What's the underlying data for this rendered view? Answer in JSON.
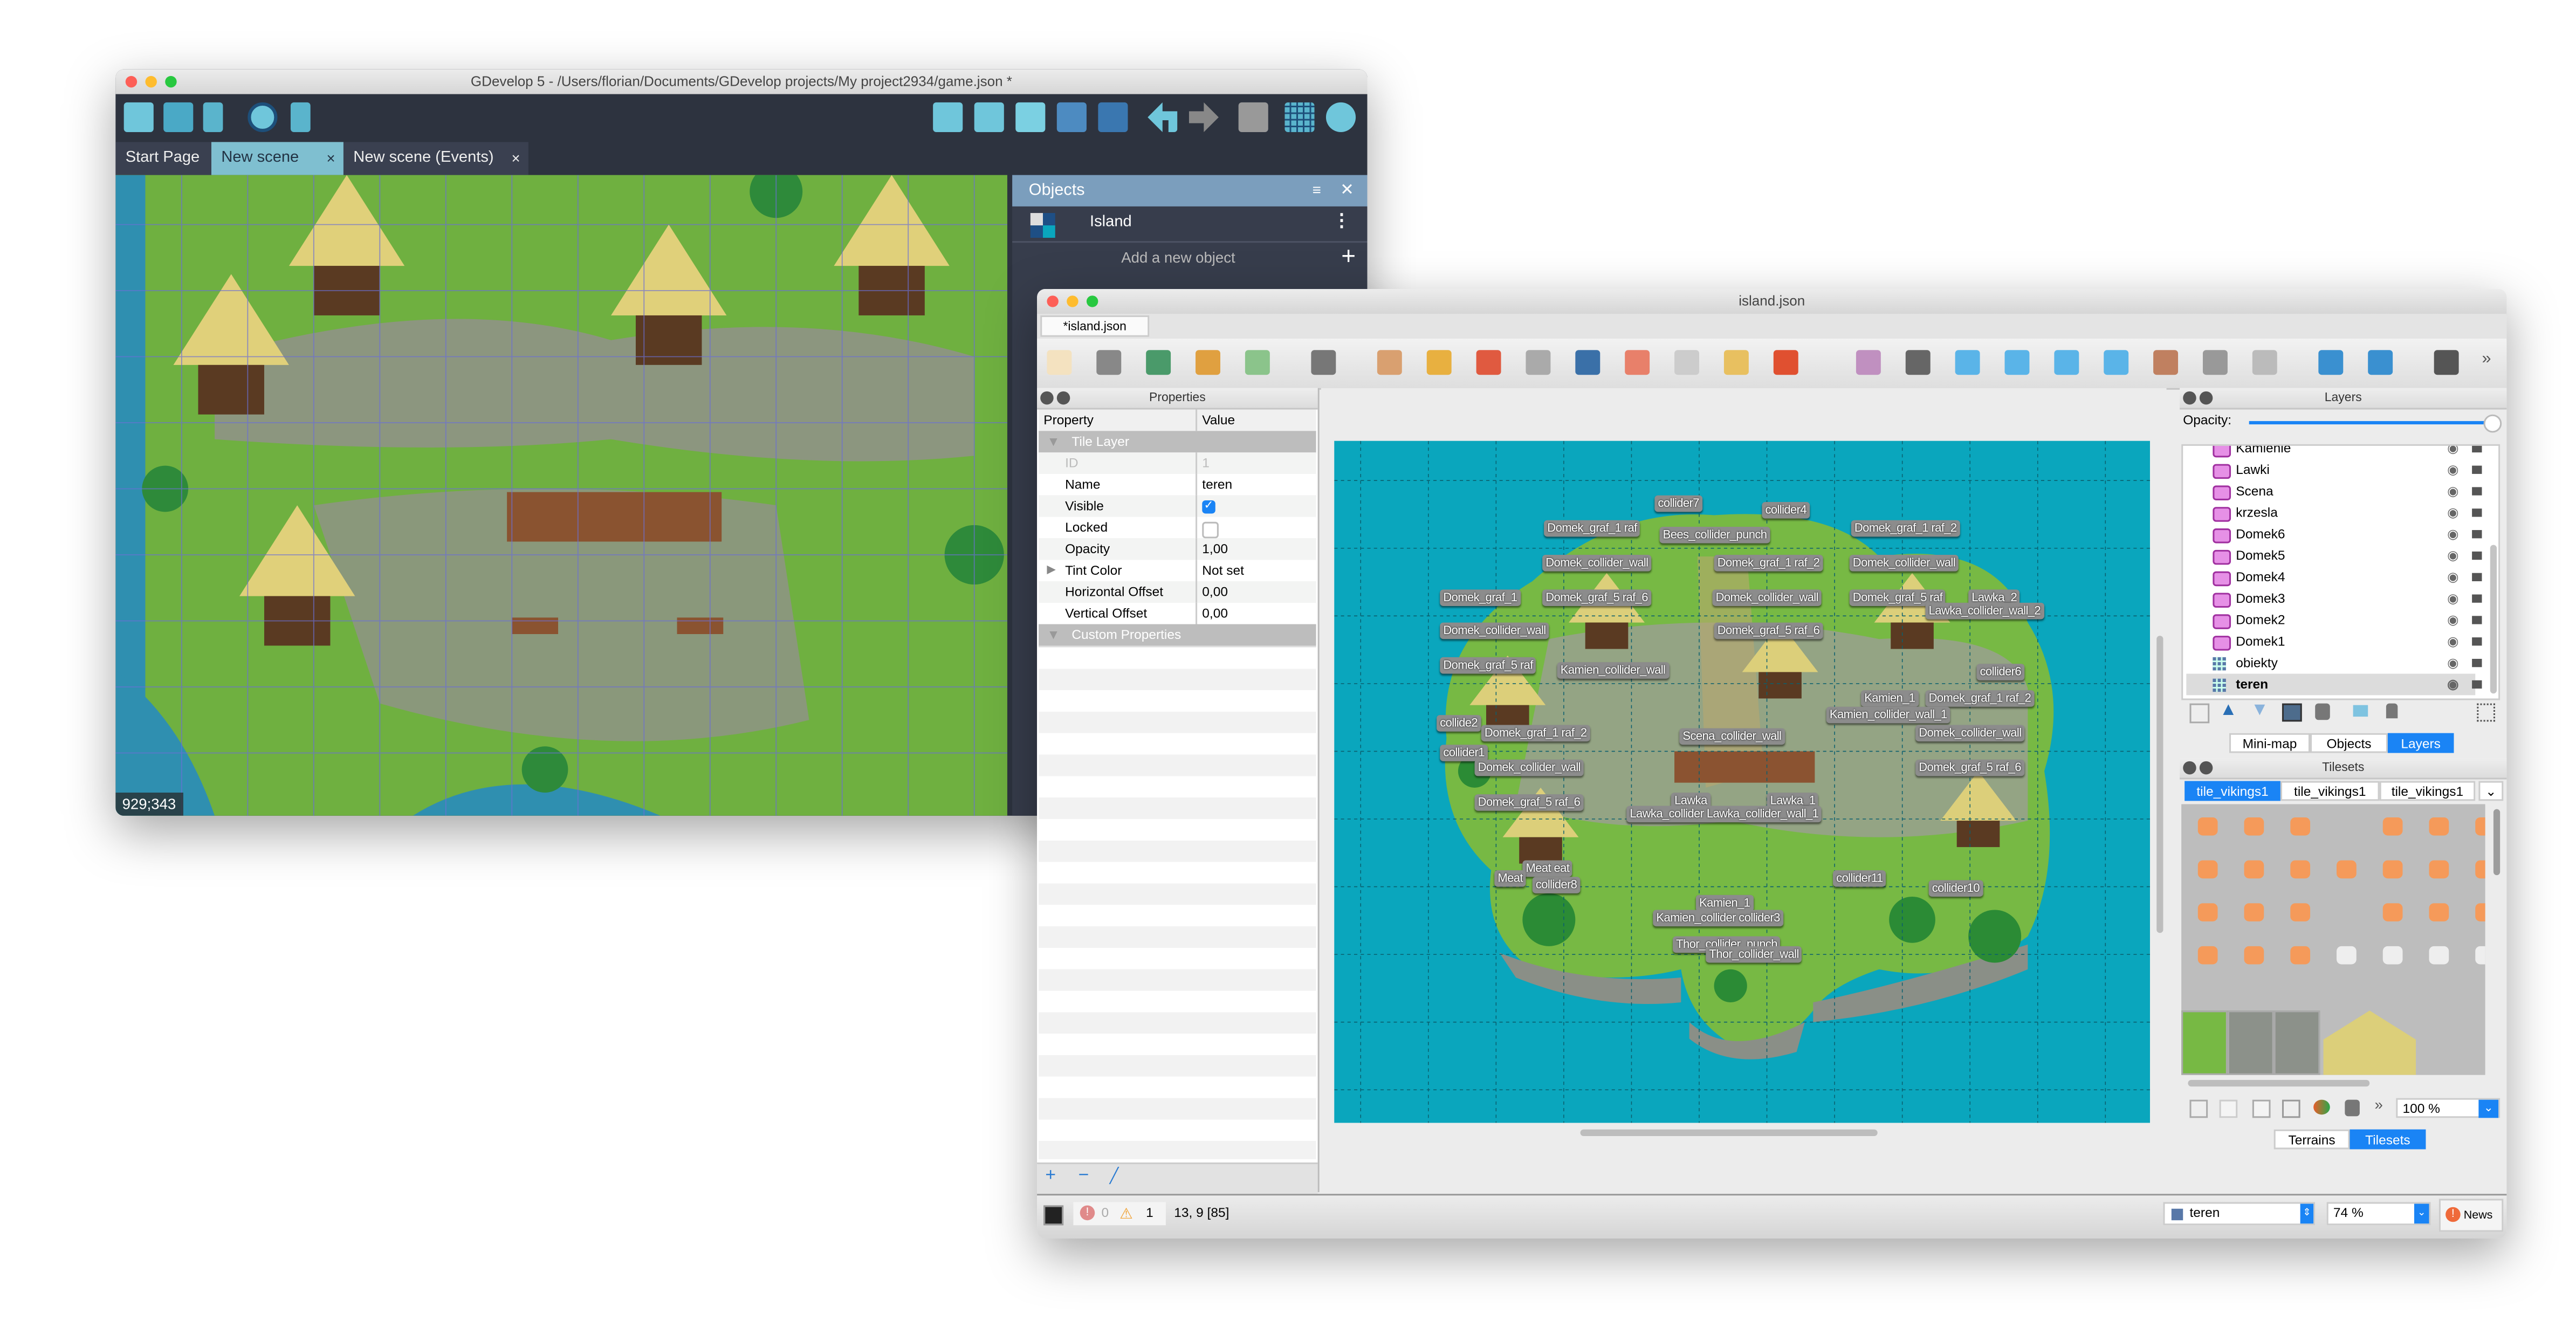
{
  "window1": {
    "title": "GDevelop 5 - /Users/florian/Documents/GDevelop projects/My project2934/game.json *",
    "tabs": [
      {
        "label": "Start Page",
        "closable": false
      },
      {
        "label": "New scene",
        "closable": true,
        "active": true
      },
      {
        "label": "New scene (Events)",
        "closable": true
      }
    ],
    "close_glyph": "×",
    "coords": "929;343",
    "objects_panel": {
      "title": "Objects",
      "items": [
        {
          "name": "Island",
          "icon": "tilemap-icon"
        }
      ],
      "add_label": "Add a new object"
    },
    "colors": {
      "toolbar_bg": "#2d333f",
      "active_tab": "#7fbfd0",
      "panel_header": "#7b9ebd"
    }
  },
  "window2": {
    "title": "island.json",
    "tab": "*island.json",
    "properties": {
      "title": "Properties",
      "headers": [
        "Property",
        "Value"
      ],
      "group": "Tile Layer",
      "rows": [
        {
          "key": "ID",
          "value": "1",
          "disabled": true
        },
        {
          "key": "Name",
          "value": "teren"
        },
        {
          "key": "Visible",
          "checkbox": true,
          "checked": true
        },
        {
          "key": "Locked",
          "checkbox": true,
          "checked": false
        },
        {
          "key": "Opacity",
          "value": "1,00"
        },
        {
          "key": "Tint Color",
          "value": "Not set",
          "expandable": true
        },
        {
          "key": "Horizontal Offset",
          "value": "0,00"
        },
        {
          "key": "Vertical Offset",
          "value": "0,00"
        }
      ],
      "group2": "Custom Properties"
    },
    "map_labels": [
      "collider7",
      "collider4",
      "Domek_graf_1 raf",
      "Bees_collider_punch",
      "Domek_graf_1 raf_2",
      "Domek_collider_wall",
      "Domek_graf_1 raf_2",
      "Domek_collider_wall",
      "Domek_graf_1",
      "Domek_graf_5 raf_6",
      "Domek_collider_wall",
      "Domek_graf_5 raf",
      "Lawka_2",
      "Lawka_collider_wall_2",
      "Domek_collider_wall",
      "Domek_graf_5 raf_6",
      "Domek_graf_5 raf",
      "Kamien_collider_wall",
      "collider6",
      "Kamien_1",
      "Domek_graf_1 raf_2",
      "Kamien_collider_wall_1",
      "collide2",
      "Domek_graf_1 raf_2",
      "Scena_collider_wall",
      "Domek_collider_wall",
      "collider1",
      "Domek_collider_wall",
      "Domek_graf_5 raf_6",
      "Domek_graf_5 raf_6",
      "Lawka",
      "Lawka_1",
      "Lawka_collider Lawka_collider_wall_1",
      "Meat eat",
      "Meat",
      "collider8",
      "collider11",
      "collider10",
      "Kamien_1",
      "Kamien_collider collider3",
      "Thor_collider_punch",
      "Thor_collider_wall"
    ],
    "layers": {
      "title": "Layers",
      "opacity_label": "Opacity:",
      "opacity": 1.0,
      "items": [
        {
          "name": "Kamienie",
          "type": "object"
        },
        {
          "name": "Lawki",
          "type": "object"
        },
        {
          "name": "Scena",
          "type": "object"
        },
        {
          "name": "krzesla",
          "type": "object"
        },
        {
          "name": "Domek6",
          "type": "object"
        },
        {
          "name": "Domek5",
          "type": "object"
        },
        {
          "name": "Domek4",
          "type": "object"
        },
        {
          "name": "Domek3",
          "type": "object"
        },
        {
          "name": "Domek2",
          "type": "object"
        },
        {
          "name": "Domek1",
          "type": "object"
        },
        {
          "name": "obiekty",
          "type": "tile"
        },
        {
          "name": "teren",
          "type": "tile",
          "selected": true
        }
      ],
      "bottom_tabs": [
        "Mini-map",
        "Objects",
        "Layers"
      ],
      "active_tab": "Layers"
    },
    "tilesets": {
      "title": "Tilesets",
      "tabs": [
        "tile_vikings1",
        "tile_vikings1",
        "tile_vikings1"
      ],
      "zoom": "100 %",
      "bottom_tabs": [
        "Terrains",
        "Tilesets"
      ],
      "active_tab": "Tilesets"
    },
    "status": {
      "errors": "0",
      "warnings": "1",
      "position": "13, 9 [85]",
      "layer": "teren",
      "zoom": "74 %",
      "news": "News"
    },
    "colors": {
      "accent": "#1a84f5",
      "map_bg": "#0aa6bd",
      "label_bg": "#8c8c8c"
    }
  }
}
